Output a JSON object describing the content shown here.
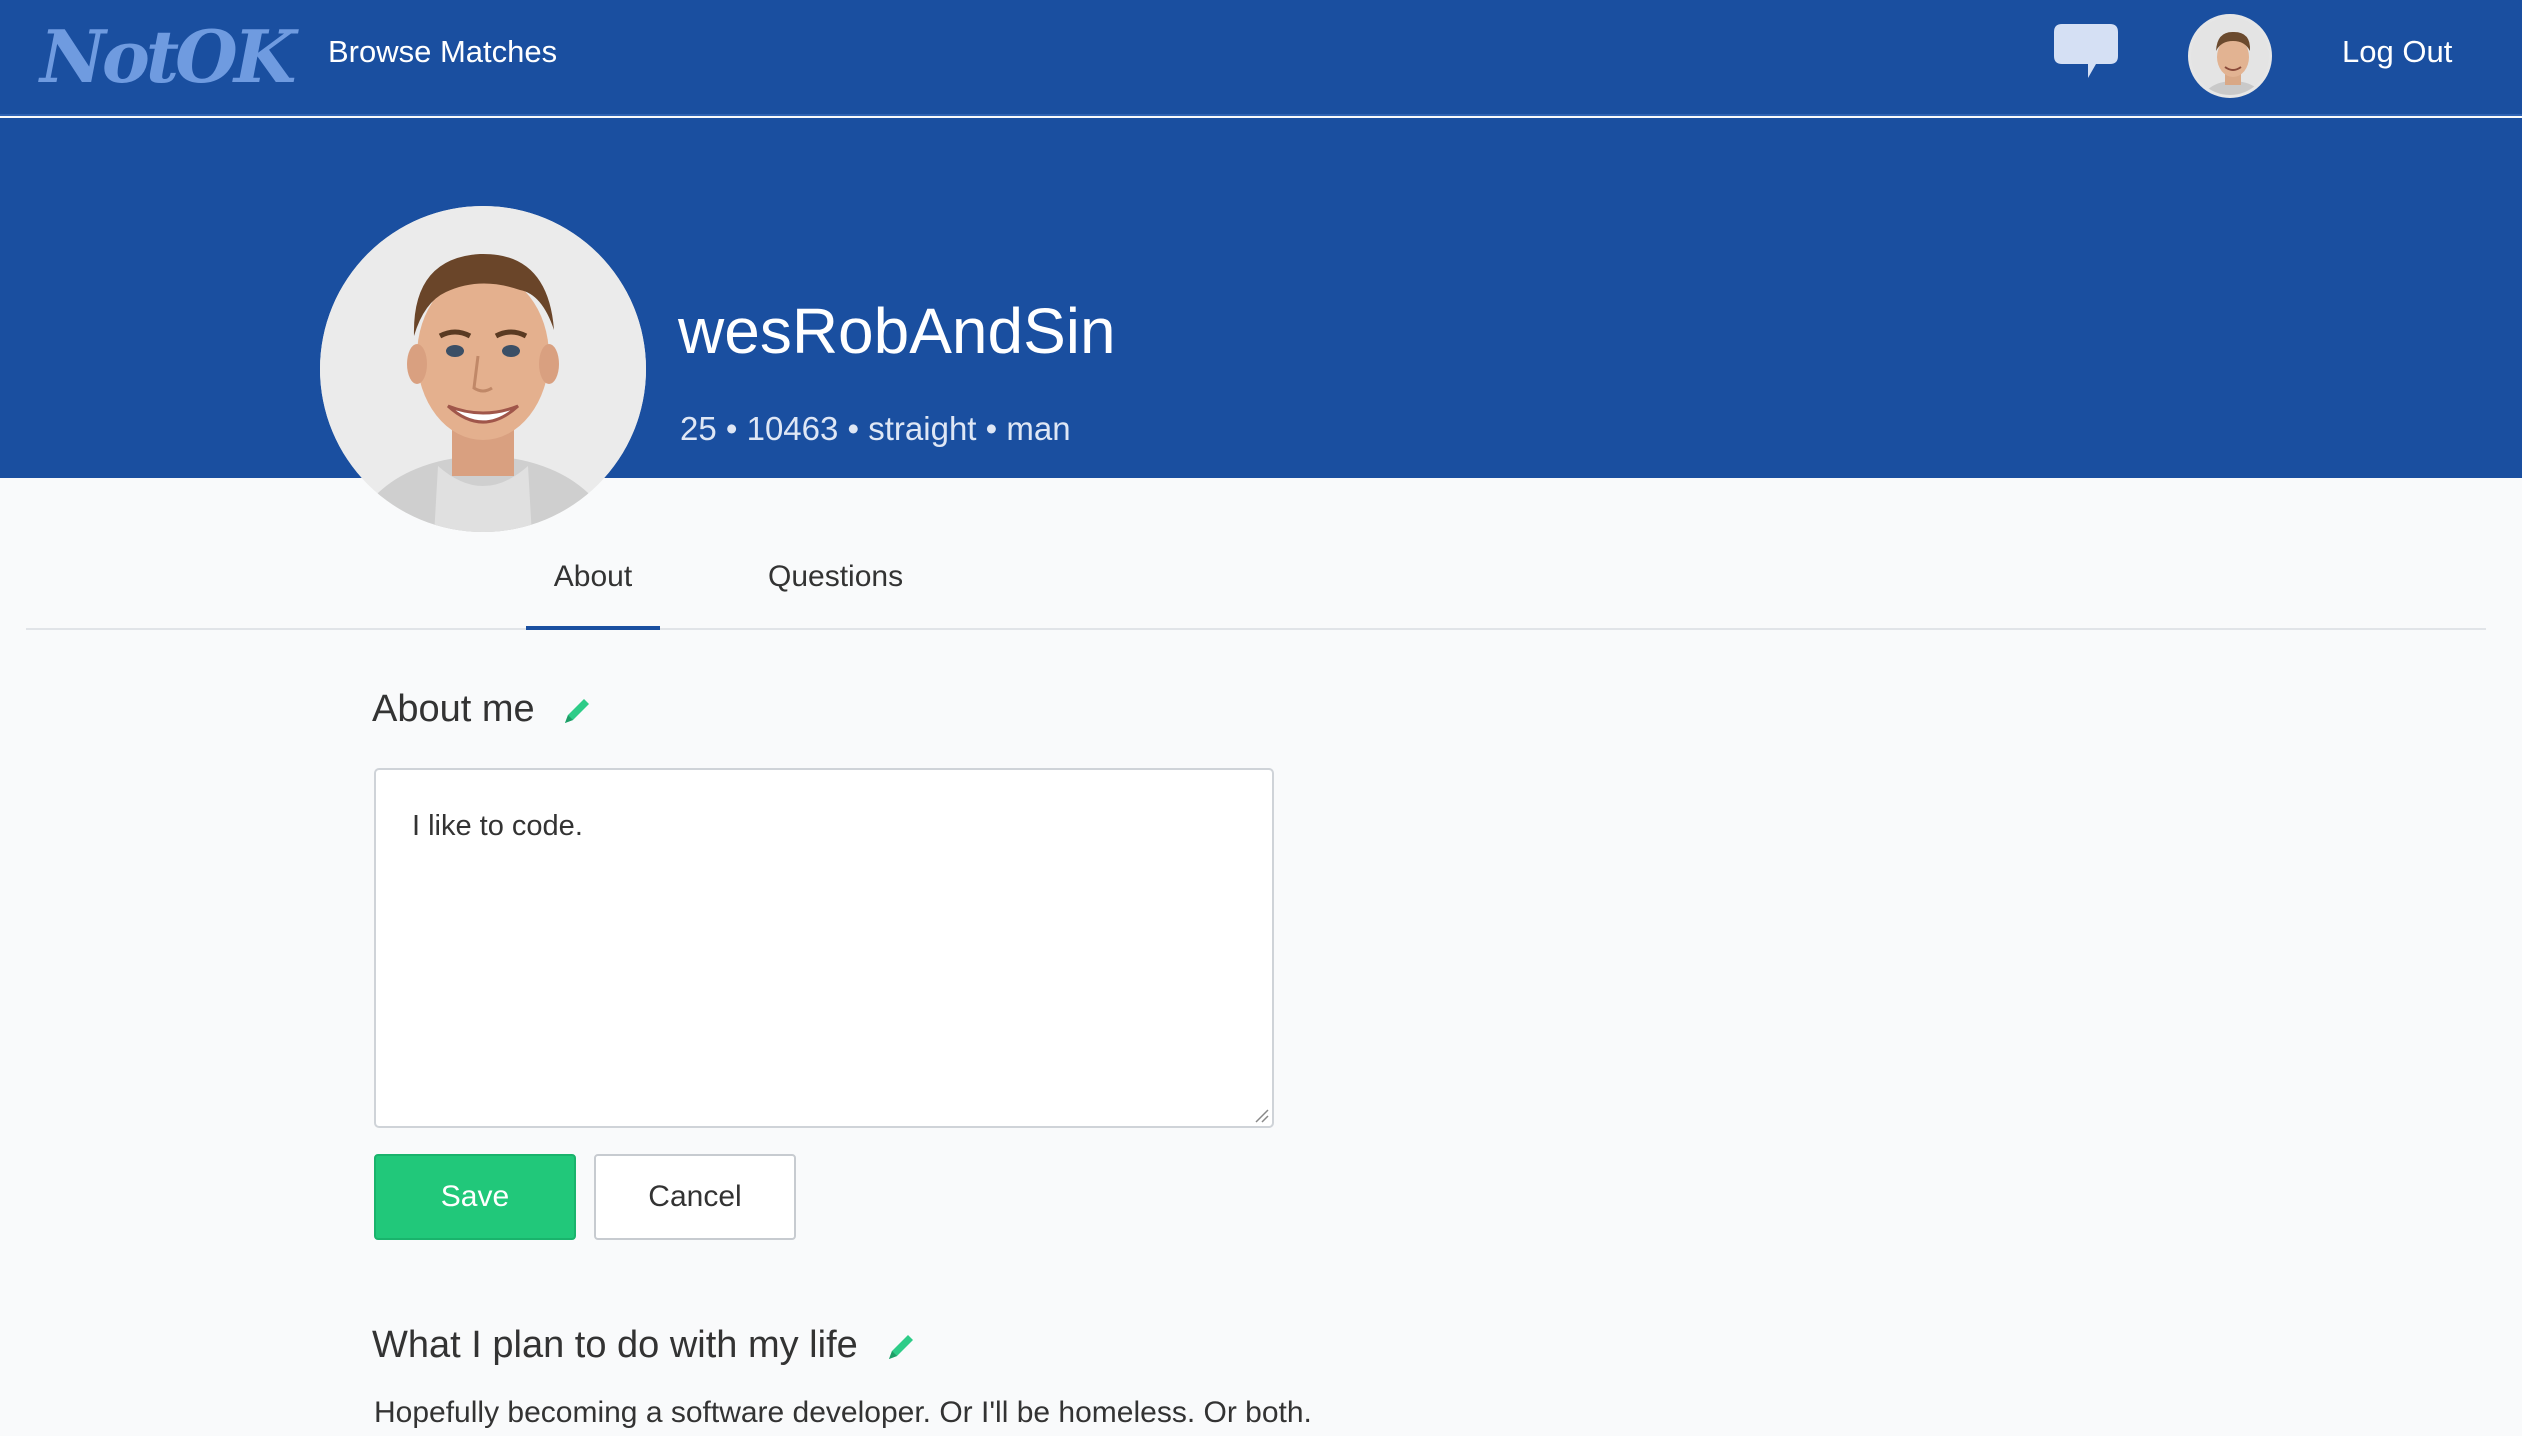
{
  "nav": {
    "logo": "NotOK",
    "browse_label": "Browse Matches",
    "chat_icon": "chat-bubble-icon",
    "logout_label": "Log Out"
  },
  "profile": {
    "username": "wesRobAndSin",
    "meta": "25 • 10463 • straight • man"
  },
  "tabs": [
    {
      "label": "About",
      "active": true
    },
    {
      "label": "Questions",
      "active": false
    }
  ],
  "about": {
    "title": "About me",
    "text": "I like to code.",
    "save_label": "Save",
    "cancel_label": "Cancel"
  },
  "plan": {
    "title": "What I plan to do with my life",
    "text": "Hopefully becoming a software developer. Or I'll be homeless. Or both."
  },
  "colors": {
    "brand": "#1a4fa0",
    "accent_green": "#21c87a"
  }
}
